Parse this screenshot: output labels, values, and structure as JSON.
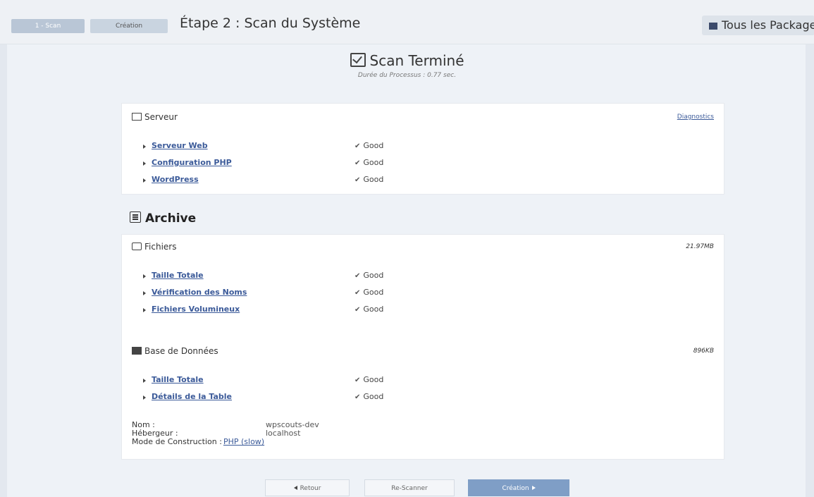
{
  "topbar": {
    "crumb_scan": "1 - Scan",
    "crumb_create": "Création",
    "step_title": "Étape 2 : Scan du Système",
    "all_packages": "Tous les Packages"
  },
  "result": {
    "title": "Scan Terminé",
    "duration": "Durée du Processus : 0.77 sec."
  },
  "server": {
    "title": "Serveur",
    "diagnostics": "Diagnostics",
    "rows": [
      {
        "label": "Serveur Web",
        "status": "Good"
      },
      {
        "label": "Configuration PHP",
        "status": "Good"
      },
      {
        "label": "WordPress",
        "status": "Good"
      }
    ]
  },
  "archive": {
    "title": "Archive",
    "files": {
      "title": "Fichiers",
      "size": "21.97MB",
      "rows": [
        {
          "label": "Taille Totale",
          "status": "Good"
        },
        {
          "label": "Vérification des Noms",
          "status": "Good"
        },
        {
          "label": "Fichiers Volumineux",
          "status": "Good"
        }
      ]
    },
    "database": {
      "title": "Base de Données",
      "size": "896KB",
      "rows": [
        {
          "label": "Taille Totale",
          "status": "Good"
        },
        {
          "label": "Détails de la Table",
          "status": "Good"
        }
      ],
      "info": {
        "name_key": "Nom :",
        "name_val": "wpscouts-dev",
        "host_key": "Hébergeur :",
        "host_val": "localhost",
        "mode_key": "Mode de Construction :",
        "mode_val": "PHP (slow)"
      }
    }
  },
  "footer": {
    "back": "Retour",
    "rescan": "Re-Scanner",
    "build": "Création"
  },
  "colors": {
    "accent": "#7f9ec6",
    "link": "#3b5a99"
  }
}
